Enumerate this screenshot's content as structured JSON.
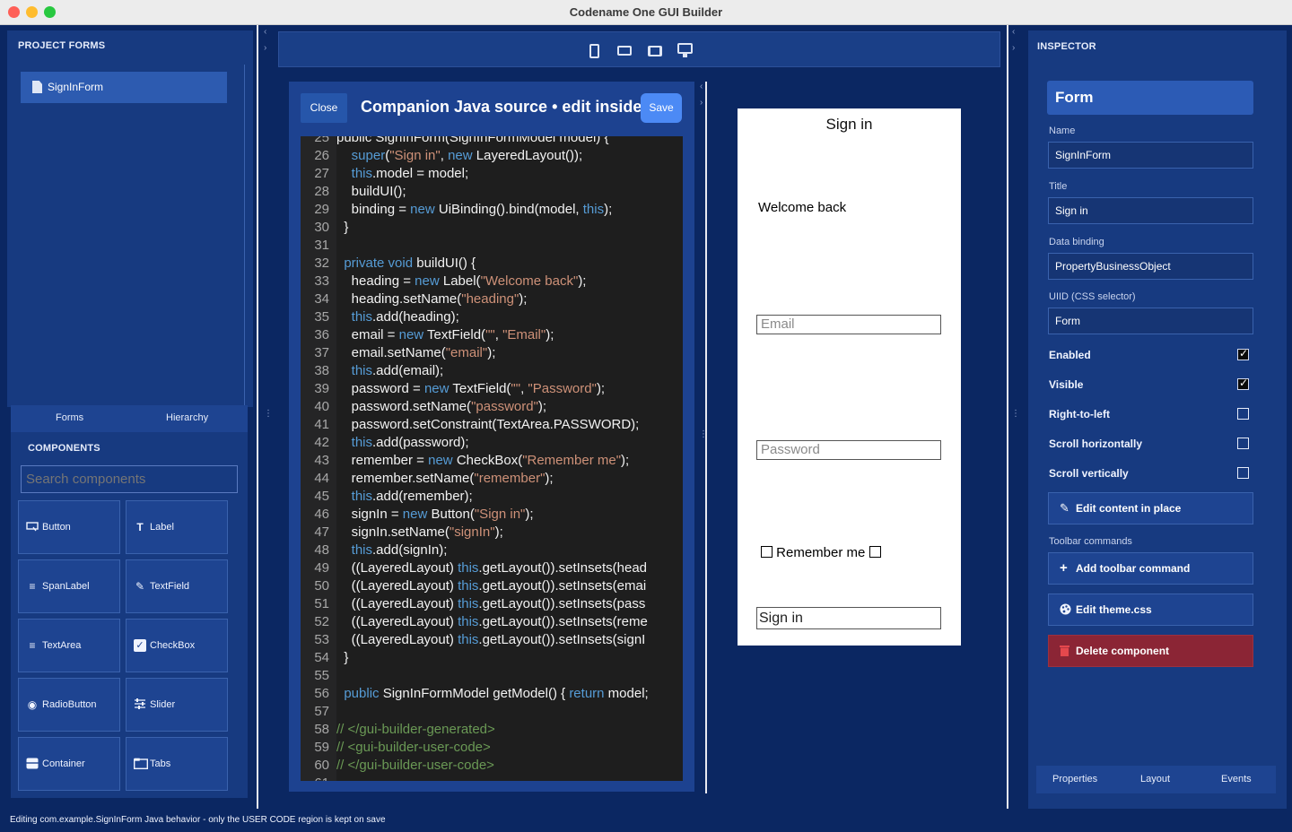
{
  "window": {
    "title": "Codename One GUI Builder"
  },
  "left": {
    "forms_header": "PROJECT FORMS",
    "forms": [
      {
        "label": "SignInForm"
      }
    ],
    "tabs": {
      "forms": "Forms",
      "hierarchy": "Hierarchy"
    },
    "components_header": "COMPONENTS",
    "search_placeholder": "Search components",
    "components": [
      {
        "label": "Button",
        "icon": "button-icon"
      },
      {
        "label": "Label",
        "icon": "label-icon"
      },
      {
        "label": "SpanLabel",
        "icon": "spanlabel-icon"
      },
      {
        "label": "TextField",
        "icon": "pencil-icon"
      },
      {
        "label": "TextArea",
        "icon": "textarea-icon"
      },
      {
        "label": "CheckBox",
        "icon": "checkbox-icon"
      },
      {
        "label": "RadioButton",
        "icon": "radio-icon"
      },
      {
        "label": "Slider",
        "icon": "slider-icon"
      },
      {
        "label": "Container",
        "icon": "container-icon"
      },
      {
        "label": "Tabs",
        "icon": "tabs-icon"
      }
    ]
  },
  "toolbar": {
    "devices": [
      "phone-icon",
      "landscape-phone-icon",
      "tablet-icon",
      "desktop-icon"
    ]
  },
  "editor": {
    "close_label": "Close",
    "title": "Companion Java source • edit inside",
    "save_label": "Save",
    "lines": [
      {
        "n": "25",
        "segs": [
          [
            "",
            "public SignInForm(SignInFormModel model) {"
          ]
        ]
      },
      {
        "n": "26",
        "segs": [
          [
            "",
            "    "
          ],
          [
            "kw",
            "super"
          ],
          [
            "",
            "("
          ],
          [
            "st",
            "\"Sign in\""
          ],
          [
            "",
            ", "
          ],
          [
            "kw",
            "new"
          ],
          [
            "",
            " LayeredLayout());"
          ]
        ]
      },
      {
        "n": "27",
        "segs": [
          [
            "",
            "    "
          ],
          [
            "kw",
            "this"
          ],
          [
            "",
            ".model = model;"
          ]
        ]
      },
      {
        "n": "28",
        "segs": [
          [
            "",
            "    buildUI();"
          ]
        ]
      },
      {
        "n": "29",
        "segs": [
          [
            "",
            "    binding = "
          ],
          [
            "kw",
            "new"
          ],
          [
            "",
            " UiBinding().bind(model, "
          ],
          [
            "kw",
            "this"
          ],
          [
            "",
            ");"
          ]
        ]
      },
      {
        "n": "30",
        "segs": [
          [
            "",
            "  }"
          ]
        ]
      },
      {
        "n": "31",
        "segs": [
          [
            "",
            ""
          ]
        ]
      },
      {
        "n": "32",
        "segs": [
          [
            "",
            "  "
          ],
          [
            "kw",
            "private void"
          ],
          [
            "",
            " buildUI() {"
          ]
        ]
      },
      {
        "n": "33",
        "segs": [
          [
            "",
            "    heading = "
          ],
          [
            "kw",
            "new"
          ],
          [
            "",
            " Label("
          ],
          [
            "st",
            "\"Welcome back\""
          ],
          [
            "",
            ");"
          ]
        ]
      },
      {
        "n": "34",
        "segs": [
          [
            "",
            "    heading.setName("
          ],
          [
            "st",
            "\"heading\""
          ],
          [
            "",
            ");"
          ]
        ]
      },
      {
        "n": "35",
        "segs": [
          [
            "",
            "    "
          ],
          [
            "kw",
            "this"
          ],
          [
            "",
            ".add(heading);"
          ]
        ]
      },
      {
        "n": "36",
        "segs": [
          [
            "",
            "    email = "
          ],
          [
            "kw",
            "new"
          ],
          [
            "",
            " TextField("
          ],
          [
            "st",
            "\"\""
          ],
          [
            "",
            ", "
          ],
          [
            "st",
            "\"Email\""
          ],
          [
            "",
            ");"
          ]
        ]
      },
      {
        "n": "37",
        "segs": [
          [
            "",
            "    email.setName("
          ],
          [
            "st",
            "\"email\""
          ],
          [
            "",
            ");"
          ]
        ]
      },
      {
        "n": "38",
        "segs": [
          [
            "",
            "    "
          ],
          [
            "kw",
            "this"
          ],
          [
            "",
            ".add(email);"
          ]
        ]
      },
      {
        "n": "39",
        "segs": [
          [
            "",
            "    password = "
          ],
          [
            "kw",
            "new"
          ],
          [
            "",
            " TextField("
          ],
          [
            "st",
            "\"\""
          ],
          [
            "",
            ", "
          ],
          [
            "st",
            "\"Password\""
          ],
          [
            "",
            ");"
          ]
        ]
      },
      {
        "n": "40",
        "segs": [
          [
            "",
            "    password.setName("
          ],
          [
            "st",
            "\"password\""
          ],
          [
            "",
            ");"
          ]
        ]
      },
      {
        "n": "41",
        "segs": [
          [
            "",
            "    password.setConstraint(TextArea.PASSWORD);"
          ]
        ]
      },
      {
        "n": "42",
        "segs": [
          [
            "",
            "    "
          ],
          [
            "kw",
            "this"
          ],
          [
            "",
            ".add(password);"
          ]
        ]
      },
      {
        "n": "43",
        "segs": [
          [
            "",
            "    remember = "
          ],
          [
            "kw",
            "new"
          ],
          [
            "",
            " CheckBox("
          ],
          [
            "st",
            "\"Remember me\""
          ],
          [
            "",
            ");"
          ]
        ]
      },
      {
        "n": "44",
        "segs": [
          [
            "",
            "    remember.setName("
          ],
          [
            "st",
            "\"remember\""
          ],
          [
            "",
            ");"
          ]
        ]
      },
      {
        "n": "45",
        "segs": [
          [
            "",
            "    "
          ],
          [
            "kw",
            "this"
          ],
          [
            "",
            ".add(remember);"
          ]
        ]
      },
      {
        "n": "46",
        "segs": [
          [
            "",
            "    signIn = "
          ],
          [
            "kw",
            "new"
          ],
          [
            "",
            " Button("
          ],
          [
            "st",
            "\"Sign in\""
          ],
          [
            "",
            ");"
          ]
        ]
      },
      {
        "n": "47",
        "segs": [
          [
            "",
            "    signIn.setName("
          ],
          [
            "st",
            "\"signIn\""
          ],
          [
            "",
            ");"
          ]
        ]
      },
      {
        "n": "48",
        "segs": [
          [
            "",
            "    "
          ],
          [
            "kw",
            "this"
          ],
          [
            "",
            ".add(signIn);"
          ]
        ]
      },
      {
        "n": "49",
        "segs": [
          [
            "",
            "    ((LayeredLayout) "
          ],
          [
            "kw",
            "this"
          ],
          [
            "",
            ".getLayout()).setInsets(head"
          ]
        ]
      },
      {
        "n": "50",
        "segs": [
          [
            "",
            "    ((LayeredLayout) "
          ],
          [
            "kw",
            "this"
          ],
          [
            "",
            ".getLayout()).setInsets(emai"
          ]
        ]
      },
      {
        "n": "51",
        "segs": [
          [
            "",
            "    ((LayeredLayout) "
          ],
          [
            "kw",
            "this"
          ],
          [
            "",
            ".getLayout()).setInsets(pass"
          ]
        ]
      },
      {
        "n": "52",
        "segs": [
          [
            "",
            "    ((LayeredLayout) "
          ],
          [
            "kw",
            "this"
          ],
          [
            "",
            ".getLayout()).setInsets(reme"
          ]
        ]
      },
      {
        "n": "53",
        "segs": [
          [
            "",
            "    ((LayeredLayout) "
          ],
          [
            "kw",
            "this"
          ],
          [
            "",
            ".getLayout()).setInsets(signI"
          ]
        ]
      },
      {
        "n": "54",
        "segs": [
          [
            "",
            "  }"
          ]
        ]
      },
      {
        "n": "55",
        "segs": [
          [
            "",
            ""
          ]
        ]
      },
      {
        "n": "56",
        "segs": [
          [
            "",
            "  "
          ],
          [
            "kw",
            "public"
          ],
          [
            "",
            " SignInFormModel getModel() { "
          ],
          [
            "kw",
            "return"
          ],
          [
            "",
            " model;"
          ]
        ]
      },
      {
        "n": "57",
        "segs": [
          [
            "",
            ""
          ]
        ]
      },
      {
        "n": "58",
        "segs": [
          [
            "cm",
            "// </gui-builder-generated>"
          ]
        ]
      },
      {
        "n": "59",
        "segs": [
          [
            "cm",
            "// <gui-builder-user-code>"
          ]
        ]
      },
      {
        "n": "60",
        "segs": [
          [
            "cm",
            "// </gui-builder-user-code>"
          ]
        ]
      },
      {
        "n": "61",
        "segs": [
          [
            "",
            ""
          ]
        ]
      }
    ]
  },
  "preview": {
    "title": "Sign in",
    "welcome": "Welcome back",
    "email_placeholder": "Email",
    "password_placeholder": "Password",
    "remember": "Remember me",
    "signin": "Sign in"
  },
  "inspector": {
    "header": "INSPECTOR",
    "component": "Form",
    "fields": [
      {
        "label": "Name",
        "value": "SignInForm"
      },
      {
        "label": "Title",
        "value": "Sign in"
      },
      {
        "label": "Data binding",
        "value": "PropertyBusinessObject"
      },
      {
        "label": "UIID (CSS selector)",
        "value": "Form"
      }
    ],
    "checks": [
      {
        "label": "Enabled",
        "checked": true
      },
      {
        "label": "Visible",
        "checked": true
      },
      {
        "label": "Right-to-left",
        "checked": false
      },
      {
        "label": "Scroll horizontally",
        "checked": false
      },
      {
        "label": "Scroll vertically",
        "checked": false
      }
    ],
    "edit_content_label": "Edit content in place",
    "toolbar_commands_label": "Toolbar commands",
    "add_toolbar_label": "Add toolbar command",
    "edit_theme_label": "Edit theme.css",
    "delete_label": "Delete component",
    "tabs": [
      "Properties",
      "Layout",
      "Events"
    ]
  },
  "status": "Editing com.example.SignInForm Java behavior - only the USER CODE region is kept on save",
  "colors": {
    "accent": "#4c8af5",
    "danger": "#8b2535",
    "background": "#0b2762",
    "panel": "#173a80"
  }
}
